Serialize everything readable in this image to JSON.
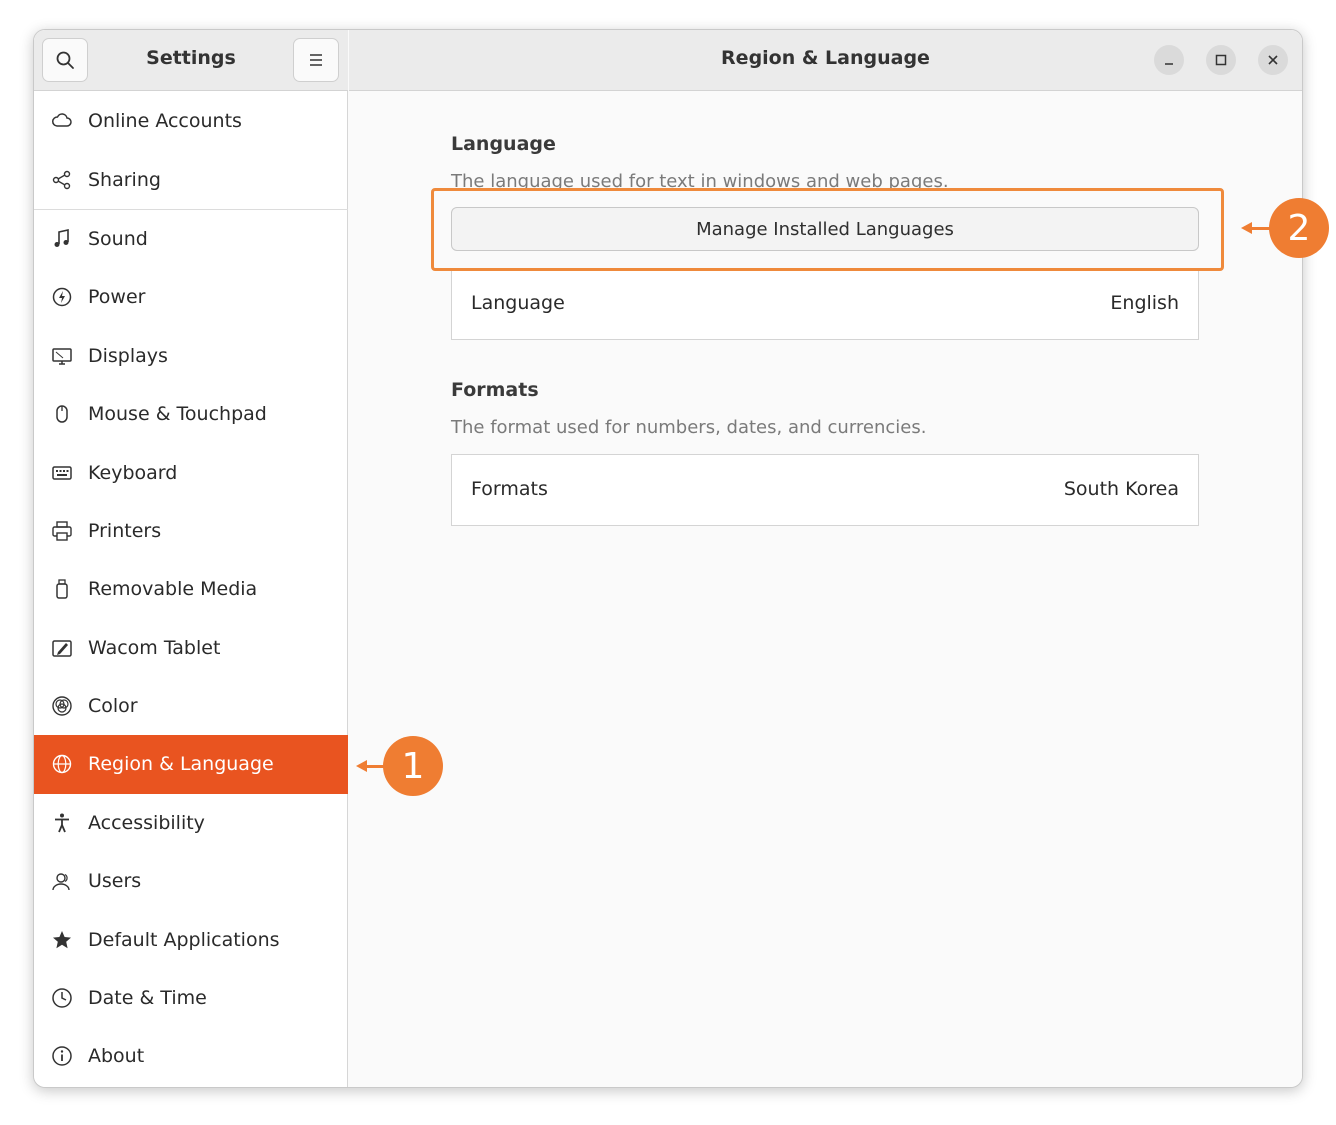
{
  "sidebar": {
    "title": "Settings",
    "items": [
      {
        "label": "Online Accounts",
        "icon": "cloud-icon"
      },
      {
        "label": "Sharing",
        "icon": "share-icon"
      },
      {
        "label": "Sound",
        "icon": "music-note-icon"
      },
      {
        "label": "Power",
        "icon": "power-icon"
      },
      {
        "label": "Displays",
        "icon": "display-icon"
      },
      {
        "label": "Mouse & Touchpad",
        "icon": "mouse-icon"
      },
      {
        "label": "Keyboard",
        "icon": "keyboard-icon"
      },
      {
        "label": "Printers",
        "icon": "printer-icon"
      },
      {
        "label": "Removable Media",
        "icon": "removable-media-icon"
      },
      {
        "label": "Wacom Tablet",
        "icon": "tablet-icon"
      },
      {
        "label": "Color",
        "icon": "color-icon"
      },
      {
        "label": "Region & Language",
        "icon": "globe-icon",
        "active": true
      },
      {
        "label": "Accessibility",
        "icon": "accessibility-icon"
      },
      {
        "label": "Users",
        "icon": "users-icon"
      },
      {
        "label": "Default Applications",
        "icon": "star-icon"
      },
      {
        "label": "Date & Time",
        "icon": "clock-icon"
      },
      {
        "label": "About",
        "icon": "info-icon"
      }
    ]
  },
  "header": {
    "title": "Region & Language"
  },
  "language": {
    "title": "Language",
    "description": "The language used for text in windows and web pages.",
    "manage_button": "Manage Installed Languages",
    "row_label": "Language",
    "row_value": "English"
  },
  "formats": {
    "title": "Formats",
    "description": "The format used for numbers, dates, and currencies.",
    "row_label": "Formats",
    "row_value": "South Korea"
  },
  "callouts": {
    "step1": "1",
    "step2": "2"
  },
  "colors": {
    "accent": "#e95420",
    "callout": "#ef7d32"
  }
}
